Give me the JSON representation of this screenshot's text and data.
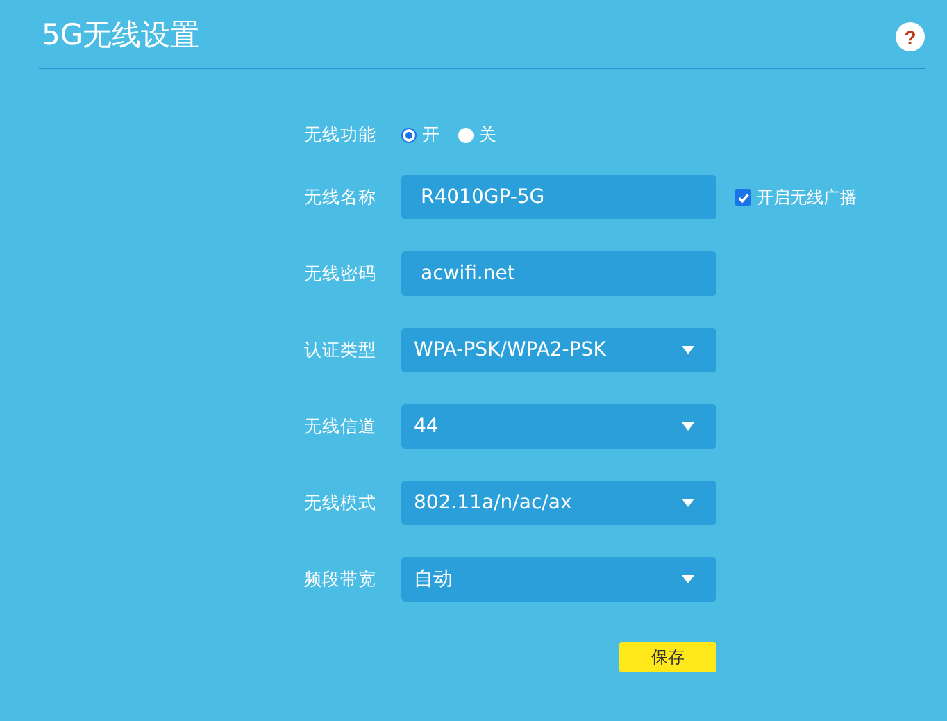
{
  "header": {
    "title": "5G无线设置",
    "help": "?"
  },
  "form": {
    "rows": [
      {
        "kind": "radio",
        "label": "无线功能",
        "options": [
          {
            "label": "开",
            "selected": true
          },
          {
            "label": "关",
            "selected": false
          }
        ]
      },
      {
        "kind": "input",
        "label": "无线名称",
        "value": "R4010GP-5G",
        "checkbox": {
          "label": "开启无线广播",
          "checked": true
        }
      },
      {
        "kind": "input",
        "label": "无线密码",
        "value": "acwifi.net"
      },
      {
        "kind": "select",
        "label": "认证类型",
        "value": "WPA-PSK/WPA2-PSK"
      },
      {
        "kind": "select",
        "label": "无线信道",
        "value": "44"
      },
      {
        "kind": "select",
        "label": "无线模式",
        "value": "802.11a/n/ac/ax"
      },
      {
        "kind": "select",
        "label": "频段带宽",
        "value": "自动"
      }
    ],
    "save_button": "保存"
  }
}
